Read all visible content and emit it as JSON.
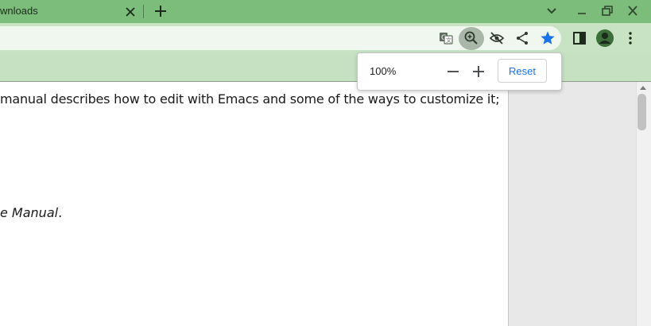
{
  "tab": {
    "title": "wnloads"
  },
  "zoom_popup": {
    "level": "100%",
    "reset_label": "Reset"
  },
  "document": {
    "line1": "manual describes how to edit with Emacs and some of the ways to customize it;",
    "line2_italic": "e Manual",
    "line2_end": "."
  },
  "icons": {
    "tab_close": "close-icon",
    "new_tab": "plus-icon",
    "tab_search": "chevron-down-icon",
    "minimize": "minimize-icon",
    "restore": "restore-icon",
    "close_window": "close-icon",
    "translate": "translate-icon",
    "zoom": "zoom-in-icon",
    "tracking": "eye-off-icon",
    "share": "share-icon",
    "bookmark": "star-icon",
    "side_panel": "side-panel-icon",
    "profile": "avatar-icon",
    "menu": "more-vert-icon"
  },
  "colors": {
    "tabstrip": "#7dbd7b",
    "toolbar": "#c7e3c4",
    "accent": "#1a73e8"
  }
}
